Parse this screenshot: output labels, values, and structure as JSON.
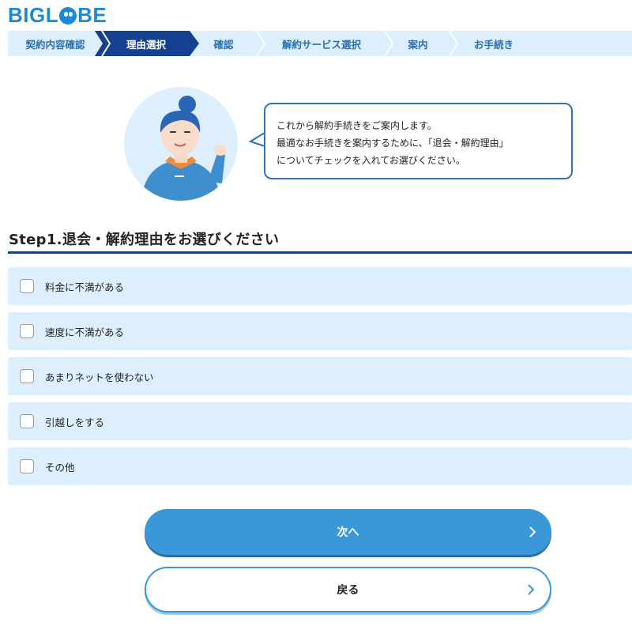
{
  "brand": {
    "logo_text_a": "BIGL",
    "logo_text_b": "BE",
    "color": "#1a8ad6"
  },
  "progress_steps": [
    {
      "label": "契約内容確認",
      "active": false
    },
    {
      "label": "理由選択",
      "active": true
    },
    {
      "label": "確認",
      "active": false
    },
    {
      "label": "解約サービス選択",
      "active": false
    },
    {
      "label": "案内",
      "active": false
    },
    {
      "label": "お手続き",
      "active": false
    }
  ],
  "guide": {
    "line1": "これから解約手続きをご案内します。",
    "line2": "最適なお手続きを案内するために、「退会・解約理由」",
    "line3": "についてチェックを入れてお選びください。"
  },
  "section_title": "Step1.退会・解約理由をお選びください",
  "reasons": [
    {
      "label": "料金に不満がある",
      "checked": false
    },
    {
      "label": "速度に不満がある",
      "checked": false
    },
    {
      "label": "あまりネットを使わない",
      "checked": false
    },
    {
      "label": "引越しをする",
      "checked": false
    },
    {
      "label": "その他",
      "checked": false
    }
  ],
  "buttons": {
    "next_label": "次へ",
    "back_label": "戻る"
  },
  "colors": {
    "accent": "#3a98d8",
    "navy": "#153f8f",
    "light_blue": "#ddeefc"
  }
}
